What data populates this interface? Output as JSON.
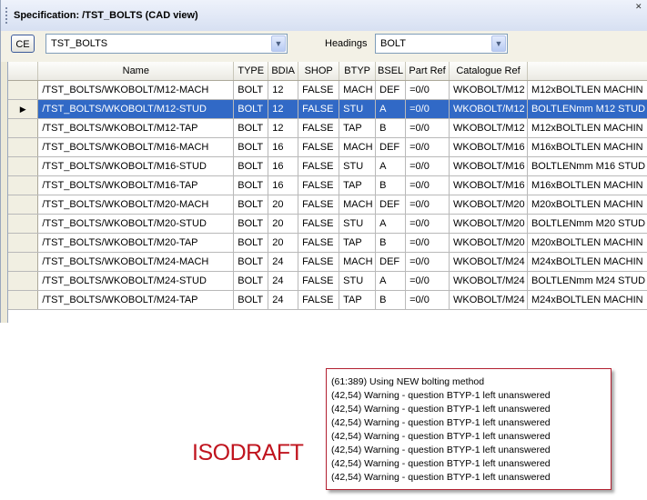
{
  "window": {
    "title": "Specification: /TST_BOLTS (CAD view)"
  },
  "toolbar": {
    "ce_label": "CE",
    "spec_value": "TST_BOLTS",
    "headings_label": "Headings",
    "headings_value": "BOLT"
  },
  "table": {
    "columns": [
      "Name",
      "TYPE",
      "BDIA",
      "SHOP",
      "BTYP",
      "BSEL",
      "Part Ref",
      "Catalogue Ref",
      ""
    ],
    "rows": [
      [
        "/TST_BOLTS/WKOBOLT/M12-MACH",
        "BOLT",
        "12",
        "FALSE",
        "MACH",
        "DEF",
        "=0/0",
        "WKOBOLT/M12",
        "M12xBOLTLEN MACHIN"
      ],
      [
        "/TST_BOLTS/WKOBOLT/M12-STUD",
        "BOLT",
        "12",
        "FALSE",
        "STU",
        "A",
        "=0/0",
        "WKOBOLT/M12",
        "BOLTLENmm M12 STUD"
      ],
      [
        "/TST_BOLTS/WKOBOLT/M12-TAP",
        "BOLT",
        "12",
        "FALSE",
        "TAP",
        "B",
        "=0/0",
        "WKOBOLT/M12",
        "M12xBOLTLEN MACHIN"
      ],
      [
        "/TST_BOLTS/WKOBOLT/M16-MACH",
        "BOLT",
        "16",
        "FALSE",
        "MACH",
        "DEF",
        "=0/0",
        "WKOBOLT/M16",
        "M16xBOLTLEN MACHIN"
      ],
      [
        "/TST_BOLTS/WKOBOLT/M16-STUD",
        "BOLT",
        "16",
        "FALSE",
        "STU",
        "A",
        "=0/0",
        "WKOBOLT/M16",
        "BOLTLENmm M16 STUD"
      ],
      [
        "/TST_BOLTS/WKOBOLT/M16-TAP",
        "BOLT",
        "16",
        "FALSE",
        "TAP",
        "B",
        "=0/0",
        "WKOBOLT/M16",
        "M16xBOLTLEN MACHIN"
      ],
      [
        "/TST_BOLTS/WKOBOLT/M20-MACH",
        "BOLT",
        "20",
        "FALSE",
        "MACH",
        "DEF",
        "=0/0",
        "WKOBOLT/M20",
        "M20xBOLTLEN MACHIN"
      ],
      [
        "/TST_BOLTS/WKOBOLT/M20-STUD",
        "BOLT",
        "20",
        "FALSE",
        "STU",
        "A",
        "=0/0",
        "WKOBOLT/M20",
        "BOLTLENmm M20 STUD"
      ],
      [
        "/TST_BOLTS/WKOBOLT/M20-TAP",
        "BOLT",
        "20",
        "FALSE",
        "TAP",
        "B",
        "=0/0",
        "WKOBOLT/M20",
        "M20xBOLTLEN MACHIN"
      ],
      [
        "/TST_BOLTS/WKOBOLT/M24-MACH",
        "BOLT",
        "24",
        "FALSE",
        "MACH",
        "DEF",
        "=0/0",
        "WKOBOLT/M24",
        "M24xBOLTLEN MACHIN"
      ],
      [
        "/TST_BOLTS/WKOBOLT/M24-STUD",
        "BOLT",
        "24",
        "FALSE",
        "STU",
        "A",
        "=0/0",
        "WKOBOLT/M24",
        "BOLTLENmm M24 STUD"
      ],
      [
        "/TST_BOLTS/WKOBOLT/M24-TAP",
        "BOLT",
        "24",
        "FALSE",
        "TAP",
        "B",
        "=0/0",
        "WKOBOLT/M24",
        "M24xBOLTLEN MACHIN"
      ]
    ],
    "selected_row": 1,
    "row_marker": "▶"
  },
  "isodraft": {
    "label": "ISODRAFT"
  },
  "log": {
    "lines": [
      "(61:389) Using NEW bolting method",
      "(42,54)   Warning - question BTYP-1 left unanswered",
      "(42,54)   Warning - question BTYP-1 left unanswered",
      "(42,54)   Warning - question BTYP-1 left unanswered",
      "(42,54)   Warning - question BTYP-1 left unanswered",
      "(42,54)   Warning - question BTYP-1 left unanswered",
      "(42,54)   Warning - question BTYP-1 left unanswered",
      "(42,54)   Warning - question BTYP-1 left unanswered"
    ]
  },
  "colors": {
    "selection": "#3169c6",
    "isodraft": "#c0141e",
    "log_border": "#b22030"
  }
}
